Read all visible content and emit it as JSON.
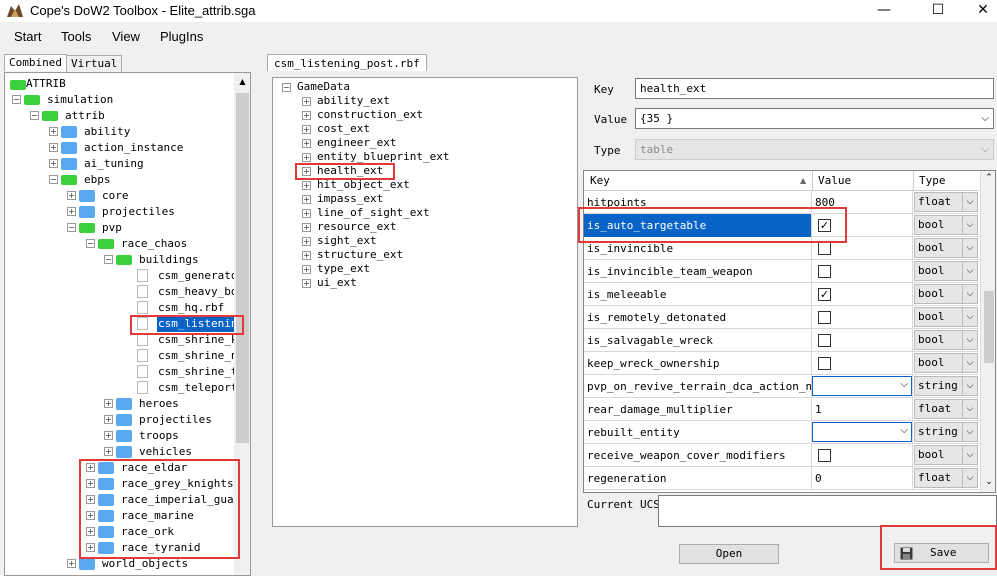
{
  "window": {
    "title": "Cope's DoW2 Toolbox - Elite_attrib.sga",
    "minimize": "—",
    "maximize": "☐",
    "close": "✕"
  },
  "menu": [
    "Start",
    "Tools",
    "View",
    "PlugIns"
  ],
  "left_tabs": [
    "Combined",
    "Virtual"
  ],
  "left_tree": {
    "root": "ATTRIB",
    "items": [
      {
        "label": "simulation",
        "level": 1,
        "icon": "green-folder",
        "expander": "−"
      },
      {
        "label": "attrib",
        "level": 2,
        "icon": "green-folder",
        "expander": "−"
      },
      {
        "label": "ability",
        "level": 3,
        "icon": "folder",
        "expander": "+"
      },
      {
        "label": "action_instance",
        "level": 3,
        "icon": "folder",
        "expander": "+"
      },
      {
        "label": "ai_tuning",
        "level": 3,
        "icon": "folder",
        "expander": "+"
      },
      {
        "label": "ebps",
        "level": 3,
        "icon": "green-folder",
        "expander": "−"
      },
      {
        "label": "core",
        "level": 4,
        "icon": "folder",
        "expander": "+"
      },
      {
        "label": "projectiles",
        "level": 4,
        "icon": "folder",
        "expander": "+"
      },
      {
        "label": "pvp",
        "level": 4,
        "icon": "green-folder",
        "expander": "−"
      },
      {
        "label": "race_chaos",
        "level": 5,
        "icon": "green-folder",
        "expander": "−"
      },
      {
        "label": "buildings",
        "level": 6,
        "icon": "green-folder",
        "expander": "−"
      },
      {
        "label": "csm_generator",
        "level": 7,
        "icon": "doc"
      },
      {
        "label": "csm_heavy_bol",
        "level": 7,
        "icon": "doc"
      },
      {
        "label": "csm_hq.rbf",
        "level": 7,
        "icon": "doc"
      },
      {
        "label": "csm_listening",
        "level": 7,
        "icon": "doc",
        "selected": true
      },
      {
        "label": "csm_shrine_kh",
        "level": 7,
        "icon": "doc"
      },
      {
        "label": "csm_shrine_nu",
        "level": 7,
        "icon": "doc"
      },
      {
        "label": "csm_shrine_tz",
        "level": 7,
        "icon": "doc"
      },
      {
        "label": "csm_teleport_",
        "level": 7,
        "icon": "doc"
      },
      {
        "label": "heroes",
        "level": 6,
        "icon": "folder",
        "expander": "+"
      },
      {
        "label": "projectiles",
        "level": 6,
        "icon": "folder",
        "expander": "+"
      },
      {
        "label": "troops",
        "level": 6,
        "icon": "folder",
        "expander": "+"
      },
      {
        "label": "vehicles",
        "level": 6,
        "icon": "folder",
        "expander": "+"
      },
      {
        "label": "race_eldar",
        "level": 5,
        "icon": "folder",
        "expander": "+"
      },
      {
        "label": "race_grey_knights",
        "level": 5,
        "icon": "folder",
        "expander": "+"
      },
      {
        "label": "race_imperial_guard",
        "level": 5,
        "icon": "folder",
        "expander": "+"
      },
      {
        "label": "race_marine",
        "level": 5,
        "icon": "folder",
        "expander": "+"
      },
      {
        "label": "race_ork",
        "level": 5,
        "icon": "folder",
        "expander": "+"
      },
      {
        "label": "race_tyranid",
        "level": 5,
        "icon": "folder",
        "expander": "+"
      },
      {
        "label": "world_objects",
        "level": 4,
        "icon": "folder",
        "expander": "+"
      }
    ]
  },
  "file_tab": "csm_listening_post.rbf",
  "mid_tree": {
    "root": "GameData",
    "items": [
      "ability_ext",
      "construction_ext",
      "cost_ext",
      "engineer_ext",
      "entity_blueprint_ext",
      "health_ext",
      "hit_object_ext",
      "impass_ext",
      "line_of_sight_ext",
      "resource_ext",
      "sight_ext",
      "structure_ext",
      "type_ext",
      "ui_ext"
    ]
  },
  "props": {
    "key_label": "Key",
    "key_value": "health_ext",
    "value_label": "Value",
    "value_value": "{35 }",
    "type_label": "Type",
    "type_value": "table"
  },
  "grid": {
    "headers": [
      "Key",
      "Value",
      "Type"
    ],
    "rows": [
      {
        "key": "hitpoints",
        "kind": "text",
        "value": "800",
        "type": "float"
      },
      {
        "key": "is_auto_targetable",
        "kind": "check",
        "checked": true,
        "type": "bool",
        "selected": true
      },
      {
        "key": "is_invincible",
        "kind": "check",
        "checked": false,
        "type": "bool"
      },
      {
        "key": "is_invincible_team_weapon",
        "kind": "check",
        "checked": false,
        "type": "bool"
      },
      {
        "key": "is_meleeable",
        "kind": "check",
        "checked": true,
        "type": "bool"
      },
      {
        "key": "is_remotely_detonated",
        "kind": "check",
        "checked": false,
        "type": "bool"
      },
      {
        "key": "is_salvagable_wreck",
        "kind": "check",
        "checked": false,
        "type": "bool"
      },
      {
        "key": "keep_wreck_ownership",
        "kind": "check",
        "checked": false,
        "type": "bool"
      },
      {
        "key": "pvp_on_revive_terrain_dca_action_name",
        "kind": "combo",
        "value": "",
        "type": "string"
      },
      {
        "key": "rear_damage_multiplier",
        "kind": "text",
        "value": "1",
        "type": "float"
      },
      {
        "key": "rebuilt_entity",
        "kind": "combo",
        "value": "",
        "type": "string"
      },
      {
        "key": "receive_weapon_cover_modifiers",
        "kind": "check",
        "checked": false,
        "type": "bool"
      },
      {
        "key": "regeneration",
        "kind": "text",
        "value": "0",
        "type": "float"
      }
    ]
  },
  "ucs_label": "Current UCS:",
  "buttons": {
    "open": "Open",
    "save": "Save"
  },
  "colors": {
    "selection": "#0a64c8",
    "highlight_box": "#e23a3a"
  }
}
